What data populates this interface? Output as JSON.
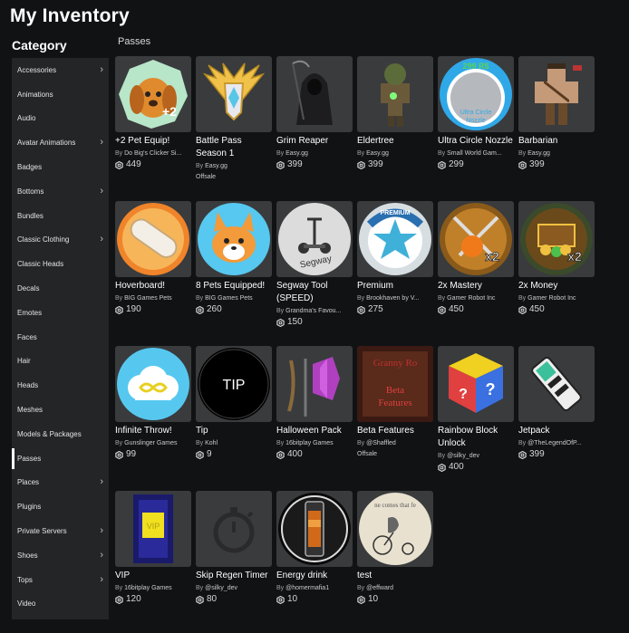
{
  "page": {
    "title": "My Inventory",
    "category_heading": "Category",
    "section_label": "Passes"
  },
  "sidebar": {
    "items": [
      {
        "label": "Accessories",
        "has_submenu": true
      },
      {
        "label": "Animations",
        "has_submenu": false
      },
      {
        "label": "Audio",
        "has_submenu": false
      },
      {
        "label": "Avatar Animations",
        "has_submenu": true
      },
      {
        "label": "Badges",
        "has_submenu": false
      },
      {
        "label": "Bottoms",
        "has_submenu": true
      },
      {
        "label": "Bundles",
        "has_submenu": false
      },
      {
        "label": "Classic Clothing",
        "has_submenu": true
      },
      {
        "label": "Classic Heads",
        "has_submenu": false
      },
      {
        "label": "Decals",
        "has_submenu": false
      },
      {
        "label": "Emotes",
        "has_submenu": false
      },
      {
        "label": "Faces",
        "has_submenu": false
      },
      {
        "label": "Hair",
        "has_submenu": false
      },
      {
        "label": "Heads",
        "has_submenu": false
      },
      {
        "label": "Meshes",
        "has_submenu": false
      },
      {
        "label": "Models & Packages",
        "has_submenu": false
      },
      {
        "label": "Passes",
        "has_submenu": false,
        "active": true
      },
      {
        "label": "Places",
        "has_submenu": true
      },
      {
        "label": "Plugins",
        "has_submenu": false
      },
      {
        "label": "Private Servers",
        "has_submenu": true
      },
      {
        "label": "Shoes",
        "has_submenu": true
      },
      {
        "label": "Tops",
        "has_submenu": true
      },
      {
        "label": "Video",
        "has_submenu": false
      }
    ]
  },
  "colors": {
    "background": "#111214",
    "sidebar": "#232527",
    "card_thumb": "#393b3d"
  },
  "items": [
    {
      "name": "+2 Pet Equip!",
      "by": "By",
      "creator": "Do Big's Clicker Si...",
      "price": "449",
      "thumb": "dog",
      "thumb_text": "+2"
    },
    {
      "name": "Battle Pass Season 1",
      "by": "By",
      "creator": "Easy.gg",
      "offsale": "Offsale",
      "thumb": "wings"
    },
    {
      "name": "Grim Reaper",
      "by": "By",
      "creator": "Easy.gg",
      "price": "399",
      "thumb": "reaper"
    },
    {
      "name": "Eldertree",
      "by": "By",
      "creator": "Easy.gg",
      "price": "399",
      "thumb": "tree"
    },
    {
      "name": "Ultra Circle Nozzle",
      "by": "By",
      "creator": "Small World Gam...",
      "price": "299",
      "thumb": "nozzle",
      "thumb_text": "299 R$",
      "thumb_text2": "Ultra Circle Nozzle"
    },
    {
      "name": "Barbarian",
      "by": "By",
      "creator": "Easy.gg",
      "price": "399",
      "thumb": "barbarian"
    },
    {
      "name": "Hoverboard!",
      "by": "By",
      "creator": "BIG Games Pets",
      "price": "190",
      "thumb": "hoverboard"
    },
    {
      "name": "8 Pets Equipped!",
      "by": "By",
      "creator": "BIG Games Pets",
      "price": "260",
      "thumb": "corgi"
    },
    {
      "name": "Segway Tool (SPEED)",
      "by": "By",
      "creator": "Grandma's Favou...",
      "price": "150",
      "thumb": "segway",
      "thumb_text": "Segway"
    },
    {
      "name": "Premium",
      "by": "By",
      "creator": "Brookhaven by V...",
      "price": "275",
      "thumb": "premium",
      "thumb_text": "PREMIUM"
    },
    {
      "name": "2x Mastery",
      "by": "By",
      "creator": "Gamer Robot Inc",
      "price": "450",
      "thumb": "mastery",
      "thumb_text": "x2"
    },
    {
      "name": "2x Money",
      "by": "By",
      "creator": "Gamer Robot Inc",
      "price": "450",
      "thumb": "money",
      "thumb_text": "x2"
    },
    {
      "name": "Infinite Throw!",
      "by": "By",
      "creator": "Gunslinger Games",
      "price": "99",
      "thumb": "cloud"
    },
    {
      "name": "Tip",
      "by": "By",
      "creator": "Kohl",
      "price": "9",
      "thumb": "tip",
      "thumb_text": "TIP"
    },
    {
      "name": "Halloween Pack",
      "by": "By",
      "creator": "16bitplay Games",
      "price": "400",
      "thumb": "halloween"
    },
    {
      "name": "Beta Features",
      "by": "By",
      "creator": "@Shaffled",
      "offsale": "Offsale",
      "thumb": "beta",
      "thumb_text": "Granny Ro",
      "thumb_text2": "Beta Features"
    },
    {
      "name": "Rainbow Block Unlock",
      "by": "By",
      "creator": "@silky_dev",
      "price": "400",
      "thumb": "rainbow"
    },
    {
      "name": "Jetpack",
      "by": "By",
      "creator": "@TheLegendOfP...",
      "price": "399",
      "thumb": "jetpack"
    },
    {
      "name": "VIP",
      "by": "By",
      "creator": "16bitplay Games",
      "price": "120",
      "thumb": "vip",
      "thumb_text": "VIP"
    },
    {
      "name": "Skip Regen Timer",
      "by": "By",
      "creator": "@silky_dev",
      "price": "80",
      "thumb": "timer"
    },
    {
      "name": "Energy drink",
      "by": "By",
      "creator": "@homermafia1",
      "price": "10",
      "thumb": "energy"
    },
    {
      "name": "test",
      "by": "By",
      "creator": "@effward",
      "price": "10",
      "thumb": "sketch",
      "thumb_text": "ne comes that fe"
    }
  ]
}
